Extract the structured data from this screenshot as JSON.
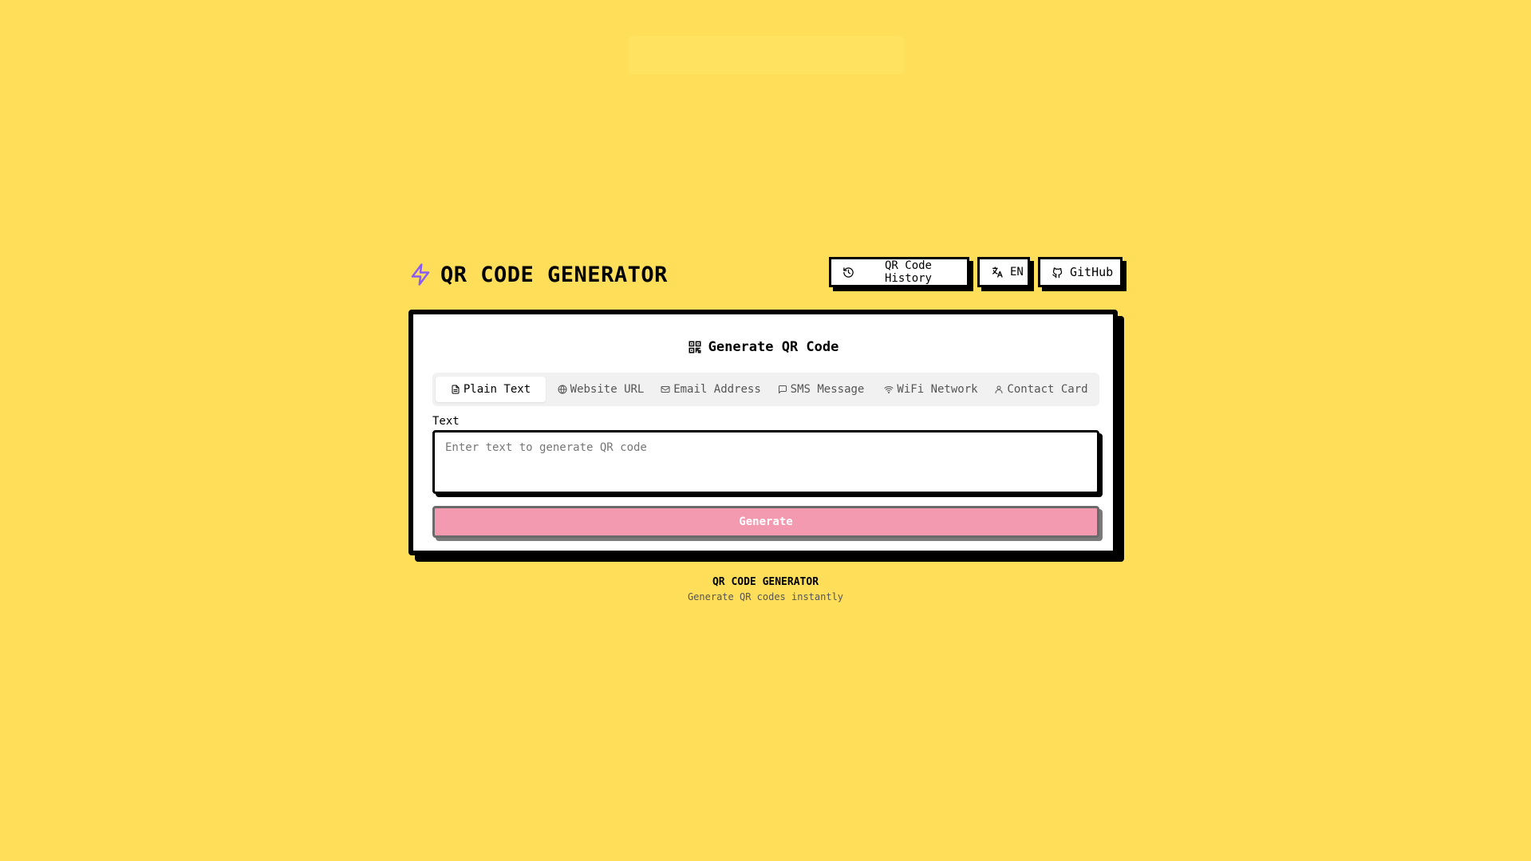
{
  "header": {
    "title": "QR CODE GENERATOR",
    "logo_icon": "lightning-icon",
    "accent_color": "#8B5CF6",
    "actions": {
      "history_label": "QR Code History",
      "language_label": "EN",
      "github_label": "GitHub"
    }
  },
  "card": {
    "title": "Generate QR Code",
    "tabs": [
      {
        "label": "Plain Text",
        "icon": "file-text-icon"
      },
      {
        "label": "Website URL",
        "icon": "globe-icon"
      },
      {
        "label": "Email Address",
        "icon": "mail-icon"
      },
      {
        "label": "SMS Message",
        "icon": "message-icon"
      },
      {
        "label": "WiFi Network",
        "icon": "wifi-icon"
      },
      {
        "label": "Contact Card",
        "icon": "user-icon"
      }
    ],
    "active_tab": "Plain Text",
    "field": {
      "label": "Text",
      "placeholder": "Enter text to generate QR code",
      "value": ""
    },
    "generate_label": "Generate"
  },
  "footer": {
    "title": "QR CODE GENERATOR",
    "subtitle": "Generate QR codes instantly"
  },
  "colors": {
    "background": "#FFDE59",
    "generate_button": "#F49AB0"
  }
}
